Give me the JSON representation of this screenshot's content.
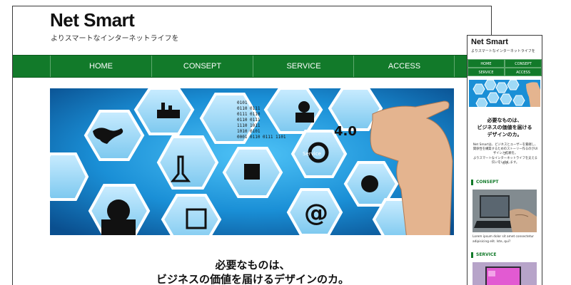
{
  "desktop": {
    "brand": "Net Smart",
    "tagline": "よりスマートなインターネットライフを",
    "nav": [
      "HOME",
      "CONSEPT",
      "SERVICE",
      "ACCESS"
    ],
    "headline_line1": "必要なものは、",
    "headline_line2": "ビジネスの価値を届けるデザインのカ。",
    "hero_badge": "4.0",
    "hero_service": "Service",
    "hero_binary": [
      "0101",
      "0110 0111",
      "0111 0110",
      "0110 0111",
      "1110 1011",
      "1010 0101",
      "0001 0110",
      "0111 1101"
    ]
  },
  "mobile": {
    "brand": "Net Smart",
    "tagline": "よりスマートなインターネットライフを",
    "nav": [
      "HOME",
      "CONSEPT",
      "SERVICE",
      "ACCESS"
    ],
    "headline_line1": "必要なものは、",
    "headline_line2": "ビジネスの価値を届ける",
    "headline_line3": "デザインのカ。",
    "intro_line1": "Net Smartは、ビジネスとユーザーを繋継し、",
    "intro_line2": "関係性を構築するためのストーリー作るのがUIデ",
    "intro_line3": "ザインと信頼を。",
    "intro_line4": "よりスマートなインターネットライフを支えるお手",
    "intro_line5": "伝いをいたします。",
    "section_concept": "CONSEPT",
    "concept_caption_line1": "Lorem ipsum dolor sit amet consectetur",
    "concept_caption_line2": "adipisicing elit. Iste, qui?",
    "section_service": "SERVICE"
  },
  "colors": {
    "accent": "#127a2a",
    "hero_blue": "#1a8fd6"
  }
}
